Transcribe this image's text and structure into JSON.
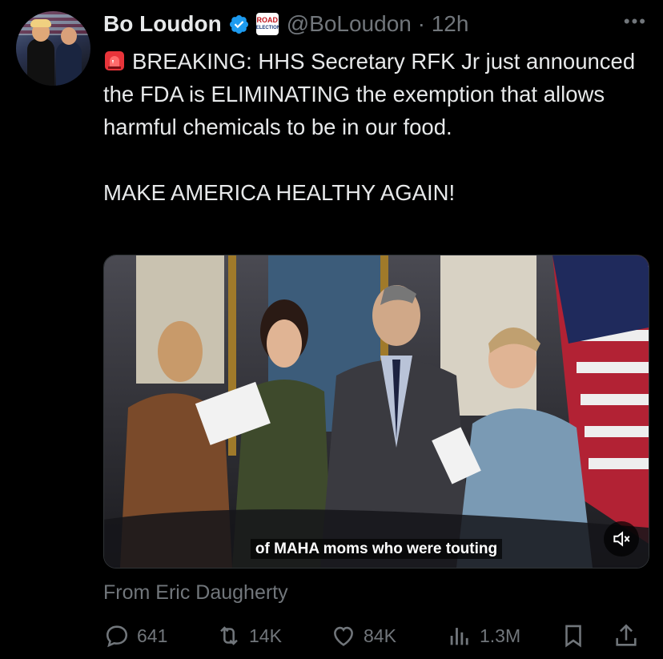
{
  "author": {
    "name": "Bo Loudon",
    "handle": "@BoLoudon",
    "time": "12h",
    "affiliate_badge_line1": "ROAD",
    "affiliate_badge_line2": "ELECTION"
  },
  "tweet": {
    "breaking_line": "BREAKING: HHS Secretary RFK Jr just announced the FDA is ELIMINATING the exemption that allows harmful chemicals to be in our food.",
    "slogan": "MAKE AMERICA HEALTHY AGAIN!"
  },
  "media": {
    "caption": "of MAHA moms who were touting"
  },
  "attribution": "From Eric Daugherty",
  "metrics": {
    "replies": "641",
    "reposts": "14K",
    "likes": "84K",
    "views": "1.3M"
  },
  "colors": {
    "background": "#000000",
    "text": "#e7e9ea",
    "muted": "#71767b",
    "verified": "#1d9bf0"
  },
  "icons": [
    "more-icon",
    "verified-icon",
    "siren-icon",
    "mute-icon",
    "reply-icon",
    "repost-icon",
    "like-icon",
    "views-icon",
    "bookmark-icon",
    "share-icon"
  ]
}
